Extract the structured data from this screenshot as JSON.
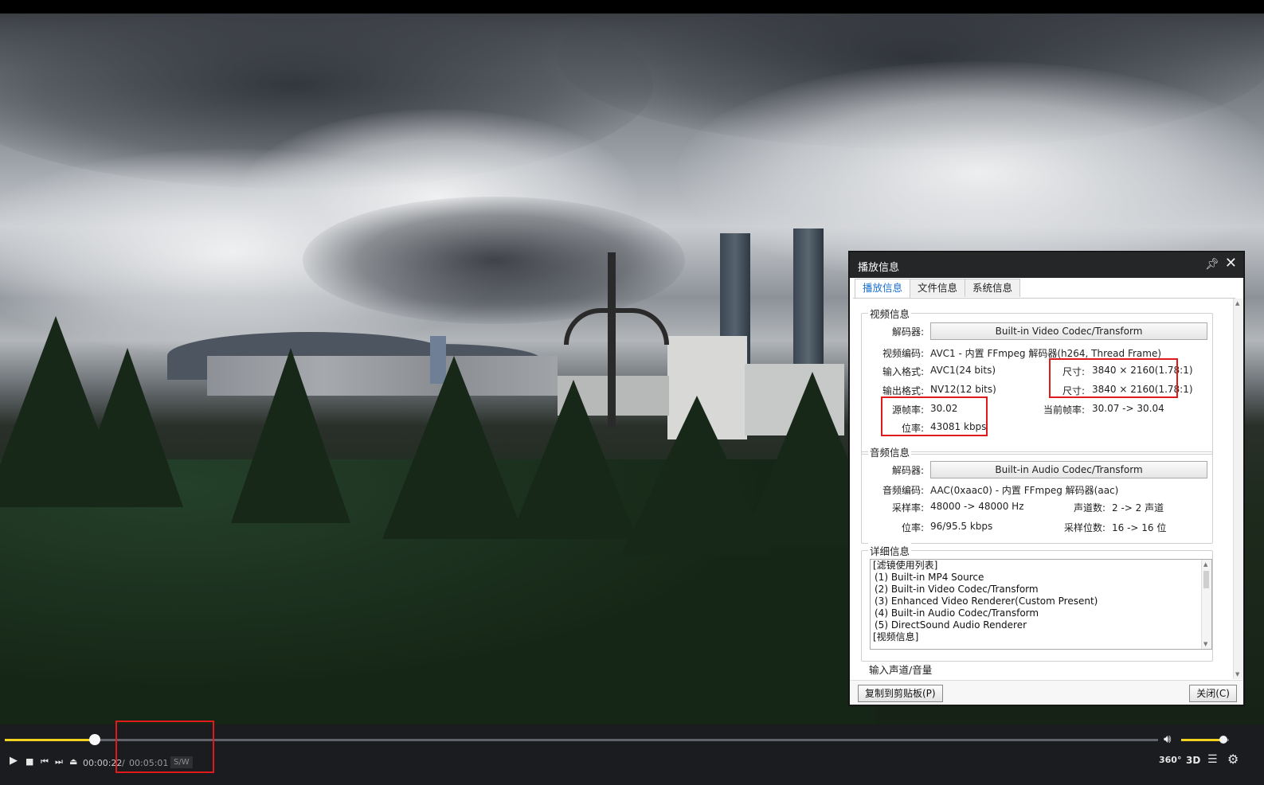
{
  "dialog": {
    "title": "播放信息",
    "pin_icon": "pin-icon",
    "close_icon": "close-icon",
    "tabs": [
      "播放信息",
      "文件信息",
      "系统信息"
    ],
    "video_info": {
      "group_title": "视频信息",
      "decoder_label": "解码器:",
      "decoder_value": "Built-in Video Codec/Transform",
      "codec_label": "视频编码:",
      "codec_value": "AVC1 - 内置 FFmpeg 解码器(h264, Thread Frame)",
      "input_format_label": "输入格式:",
      "input_format_value": "AVC1(24 bits)",
      "output_format_label": "输出格式:",
      "output_format_value": "NV12(12 bits)",
      "size_label_1": "尺寸:",
      "size_value_1": "3840 × 2160(1.78:1)",
      "size_label_2": "尺寸:",
      "size_value_2": "3840 × 2160(1.78:1)",
      "source_fps_label": "源帧率:",
      "source_fps_value": "30.02",
      "bitrate_label": "位率:",
      "bitrate_value": "43081 kbps",
      "current_fps_label": "当前帧率:",
      "current_fps_value": "30.07 -> 30.04"
    },
    "audio_info": {
      "group_title": "音频信息",
      "decoder_label": "解码器:",
      "decoder_value": "Built-in Audio Codec/Transform",
      "codec_label": "音频编码:",
      "codec_value": "AAC(0xaac0) - 内置 FFmpeg 解码器(aac)",
      "samplerate_label": "采样率:",
      "samplerate_value": "48000 -> 48000 Hz",
      "channels_label": "声道数:",
      "channels_value": "2 -> 2 声道",
      "bitrate_label": "位率:",
      "bitrate_value": "96/95.5 kbps",
      "bitdepth_label": "采样位数:",
      "bitdepth_value": "16 -> 16 位"
    },
    "detail_info": {
      "group_title": "详细信息",
      "lines": [
        "[滤镜使用列表]",
        "(1) Built-in MP4 Source",
        "(2) Built-in Video Codec/Transform",
        "(3) Enhanced Video Renderer(Custom Present)",
        "(4) Built-in Audio Codec/Transform",
        "(5) DirectSound Audio Renderer",
        "[视频信息]"
      ]
    },
    "input_channel_group_title": "输入声道/音量",
    "copy_button": "复制到剪贴板(P)",
    "close_button": "关闭(C)"
  },
  "player": {
    "seek_progress": 0.078,
    "volume_level": 0.88,
    "time_current": "00:00:22",
    "time_separator": "/",
    "time_total": "00:05:01",
    "hw_badge": "S/W",
    "accent_color": "#f2d21e",
    "buttons": {
      "play": "play-icon",
      "stop": "stop-icon",
      "prev": "previous-icon",
      "next": "next-icon",
      "eject": "eject-icon",
      "volume": "volume-icon",
      "vr360": "360°",
      "three_d": "3D",
      "playlist": "playlist-icon",
      "settings": "gear-icon"
    }
  },
  "annotation_color": "#e0191b"
}
